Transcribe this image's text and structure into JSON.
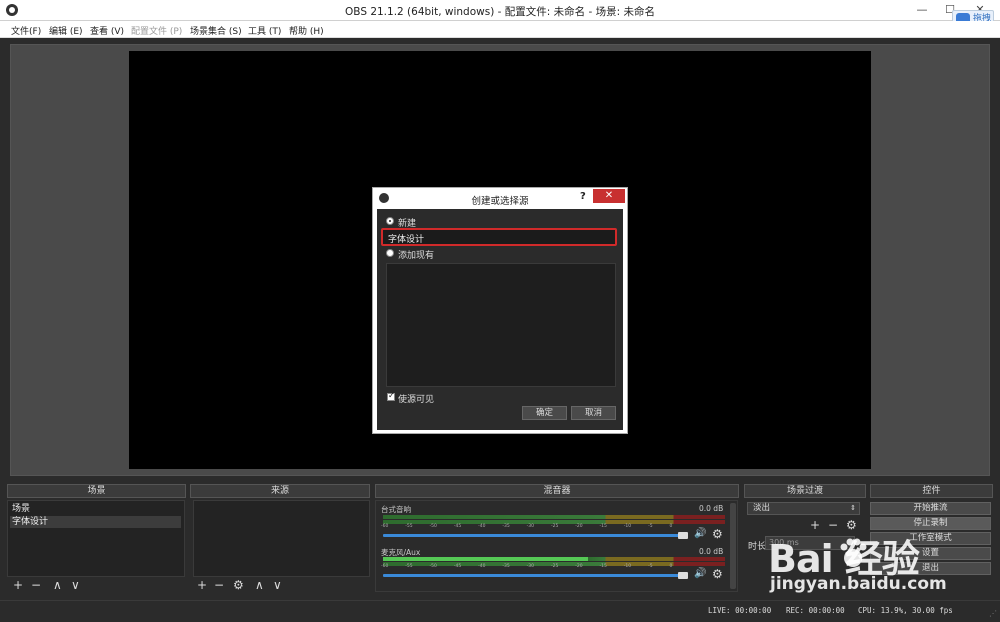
{
  "window": {
    "title": "OBS 21.1.2 (64bit, windows) - 配置文件: 未命名 - 场景: 未命名",
    "minimize": "—",
    "maximize": "☐",
    "close": "✕",
    "cloud_button": "拖拽"
  },
  "menu": [
    {
      "label": "文件(F)",
      "enabled": true
    },
    {
      "label": "编辑 (E)",
      "enabled": true
    },
    {
      "label": "查看 (V)",
      "enabled": true
    },
    {
      "label": "配置文件 (P)",
      "enabled": false
    },
    {
      "label": "场景集合 (S)",
      "enabled": true
    },
    {
      "label": "工具 (T)",
      "enabled": true
    },
    {
      "label": "帮助 (H)",
      "enabled": true
    }
  ],
  "dialog": {
    "title": "创建或选择源",
    "help": "?",
    "close": "✕",
    "radio_new": "新建",
    "name_value": "字体设计",
    "radio_existing": "添加现有",
    "make_visible": "使源可见",
    "ok": "确定",
    "cancel": "取消"
  },
  "docks": {
    "scenes": {
      "title": "场景",
      "items": [
        "场景",
        "字体设计"
      ]
    },
    "sources": {
      "title": "来源"
    },
    "mixer": {
      "title": "混音器",
      "tracks": [
        {
          "name": "台式音响",
          "db": "0.0 dB",
          "ticks": "-60 -55 -50 -45 -40 -35 -30 -25 -20 -15 -10 -5 0",
          "level": 0
        },
        {
          "name": "麦克风/Aux",
          "db": "0.0 dB",
          "ticks": "-60 -55 -50 -45 -40 -35 -30 -25 -20 -15 -10 -5 0",
          "level": 0.6
        }
      ]
    },
    "transitions": {
      "title": "场景过渡",
      "selected": "淡出",
      "duration_label": "时长",
      "duration_value": "300 ms"
    },
    "controls": {
      "title": "控件",
      "buttons": [
        "开始推流",
        "停止录制",
        "工作室模式",
        "设置",
        "退出"
      ]
    }
  },
  "icons": {
    "plus": "+",
    "minus": "−",
    "up": "∧",
    "down": "∨",
    "gear": "⚙",
    "volume": "🔊"
  },
  "status": {
    "live": "LIVE: 00:00:00",
    "rec": "REC: 00:00:00",
    "cpu": "CPU: 13.9%, 30.00 fps"
  },
  "watermark": {
    "brand": "Bai  经验",
    "url": "jingyan.baidu.com"
  }
}
